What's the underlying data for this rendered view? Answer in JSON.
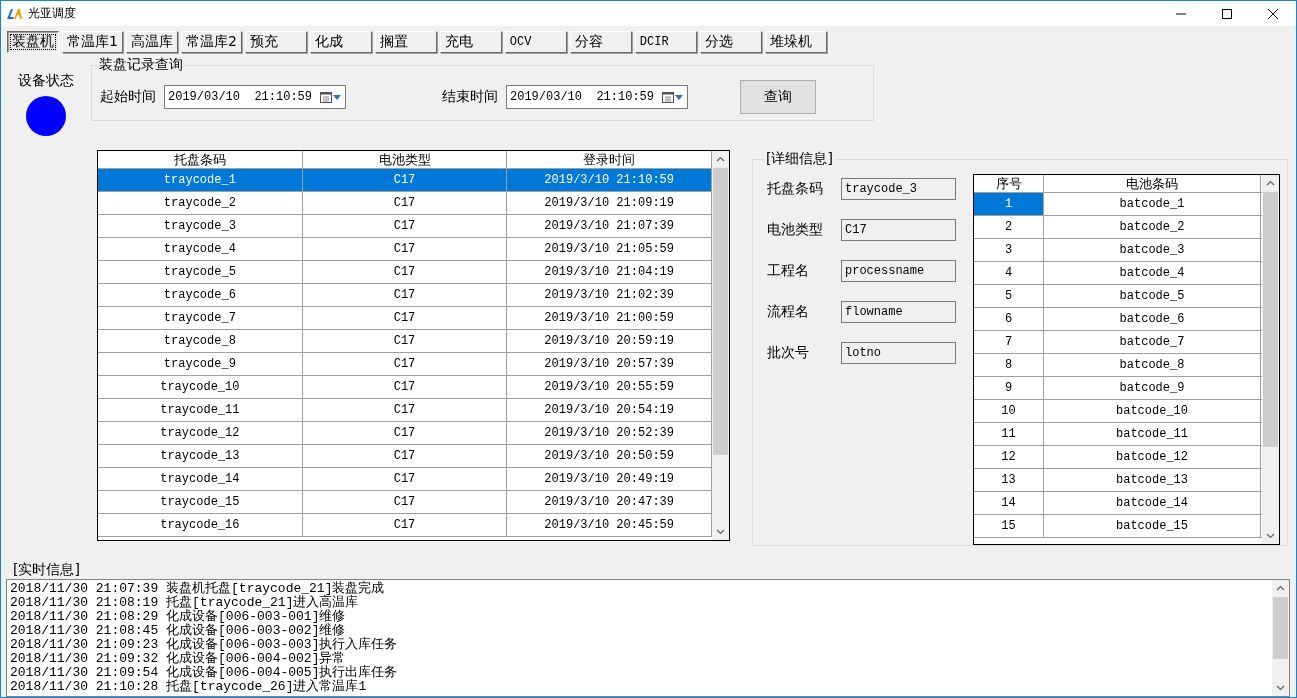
{
  "window": {
    "title": "光亚调度"
  },
  "tabs": [
    {
      "label": "装盘机",
      "selected": true
    },
    {
      "label": "常温库1",
      "selected": false
    },
    {
      "label": "高温库",
      "selected": false
    },
    {
      "label": "常温库2",
      "selected": false
    },
    {
      "label": "预充",
      "selected": false
    },
    {
      "label": "化成",
      "selected": false
    },
    {
      "label": "搁置",
      "selected": false
    },
    {
      "label": "充电",
      "selected": false
    },
    {
      "label": "OCV",
      "selected": false
    },
    {
      "label": "分容",
      "selected": false
    },
    {
      "label": "DCIR",
      "selected": false
    },
    {
      "label": "分选",
      "selected": false
    },
    {
      "label": "堆垛机",
      "selected": false
    }
  ],
  "device_status": {
    "label": "设备状态",
    "color": "#0000ff"
  },
  "query": {
    "title": "装盘记录查询",
    "start_label": "起始时间",
    "start_value": "2019/03/10  21:10:59",
    "end_label": "结束时间",
    "end_value": "2019/03/10  21:10:59",
    "button": "查询"
  },
  "tray_table": {
    "columns": [
      "托盘条码",
      "电池类型",
      "登录时间"
    ],
    "rows": [
      {
        "cells": [
          "traycode_1",
          "C17",
          "2019/3/10 21:10:59"
        ],
        "selected": true
      },
      {
        "cells": [
          "traycode_2",
          "C17",
          "2019/3/10 21:09:19"
        ],
        "selected": false
      },
      {
        "cells": [
          "traycode_3",
          "C17",
          "2019/3/10 21:07:39"
        ],
        "selected": false
      },
      {
        "cells": [
          "traycode_4",
          "C17",
          "2019/3/10 21:05:59"
        ],
        "selected": false
      },
      {
        "cells": [
          "traycode_5",
          "C17",
          "2019/3/10 21:04:19"
        ],
        "selected": false
      },
      {
        "cells": [
          "traycode_6",
          "C17",
          "2019/3/10 21:02:39"
        ],
        "selected": false
      },
      {
        "cells": [
          "traycode_7",
          "C17",
          "2019/3/10 21:00:59"
        ],
        "selected": false
      },
      {
        "cells": [
          "traycode_8",
          "C17",
          "2019/3/10 20:59:19"
        ],
        "selected": false
      },
      {
        "cells": [
          "traycode_9",
          "C17",
          "2019/3/10 20:57:39"
        ],
        "selected": false
      },
      {
        "cells": [
          "traycode_10",
          "C17",
          "2019/3/10 20:55:59"
        ],
        "selected": false
      },
      {
        "cells": [
          "traycode_11",
          "C17",
          "2019/3/10 20:54:19"
        ],
        "selected": false
      },
      {
        "cells": [
          "traycode_12",
          "C17",
          "2019/3/10 20:52:39"
        ],
        "selected": false
      },
      {
        "cells": [
          "traycode_13",
          "C17",
          "2019/3/10 20:50:59"
        ],
        "selected": false
      },
      {
        "cells": [
          "traycode_14",
          "C17",
          "2019/3/10 20:49:19"
        ],
        "selected": false
      },
      {
        "cells": [
          "traycode_15",
          "C17",
          "2019/3/10 20:47:39"
        ],
        "selected": false
      },
      {
        "cells": [
          "traycode_16",
          "C17",
          "2019/3/10 20:45:59"
        ],
        "selected": false
      }
    ]
  },
  "detail": {
    "title": "[详细信息]",
    "fields": [
      {
        "label": "托盘条码",
        "value": "traycode_3"
      },
      {
        "label": "电池类型",
        "value": "C17"
      },
      {
        "label": "工程名",
        "value": "processname"
      },
      {
        "label": "流程名",
        "value": "flowname"
      },
      {
        "label": "批次号",
        "value": "lotno"
      }
    ],
    "battery_table": {
      "columns": [
        "序号",
        "电池条码"
      ],
      "rows": [
        {
          "cells": [
            "1",
            "batcode_1"
          ],
          "selected": true
        },
        {
          "cells": [
            "2",
            "batcode_2"
          ],
          "selected": false
        },
        {
          "cells": [
            "3",
            "batcode_3"
          ],
          "selected": false
        },
        {
          "cells": [
            "4",
            "batcode_4"
          ],
          "selected": false
        },
        {
          "cells": [
            "5",
            "batcode_5"
          ],
          "selected": false
        },
        {
          "cells": [
            "6",
            "batcode_6"
          ],
          "selected": false
        },
        {
          "cells": [
            "7",
            "batcode_7"
          ],
          "selected": false
        },
        {
          "cells": [
            "8",
            "batcode_8"
          ],
          "selected": false
        },
        {
          "cells": [
            "9",
            "batcode_9"
          ],
          "selected": false
        },
        {
          "cells": [
            "10",
            "batcode_10"
          ],
          "selected": false
        },
        {
          "cells": [
            "11",
            "batcode_11"
          ],
          "selected": false
        },
        {
          "cells": [
            "12",
            "batcode_12"
          ],
          "selected": false
        },
        {
          "cells": [
            "13",
            "batcode_13"
          ],
          "selected": false
        },
        {
          "cells": [
            "14",
            "batcode_14"
          ],
          "selected": false
        },
        {
          "cells": [
            "15",
            "batcode_15"
          ],
          "selected": false
        }
      ]
    }
  },
  "log": {
    "title": "[实时信息]",
    "lines": [
      "2018/11/30 21:07:39 装盘机托盘[traycode_21]装盘完成",
      "2018/11/30 21:08:19 托盘[traycode_21]进入高温库",
      "2018/11/30 21:08:29 化成设备[006-003-001]维修",
      "2018/11/30 21:08:45 化成设备[006-003-002]维修",
      "2018/11/30 21:09:23 化成设备[006-003-003]执行入库任务",
      "2018/11/30 21:09:32 化成设备[006-004-002]异常",
      "2018/11/30 21:09:54 化成设备[006-004-005]执行出库任务",
      "2018/11/30 21:10:28 托盘[traycode_26]进入常温库1"
    ]
  }
}
